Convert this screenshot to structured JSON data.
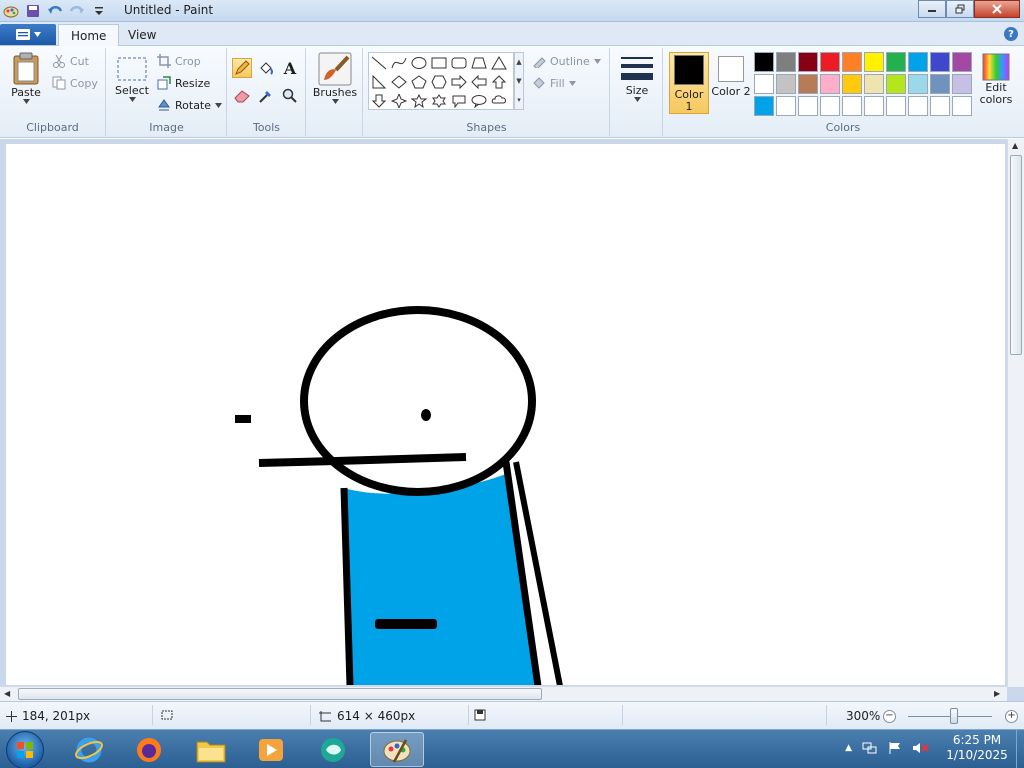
{
  "window": {
    "title": "Untitled - Paint"
  },
  "tabs": [
    {
      "label": "Home"
    },
    {
      "label": "View"
    }
  ],
  "clipboard": {
    "paste": "Paste",
    "cut": "Cut",
    "copy": "Copy",
    "group": "Clipboard"
  },
  "image": {
    "select": "Select",
    "crop": "Crop",
    "resize": "Resize",
    "rotate": "Rotate",
    "group": "Image"
  },
  "tools": {
    "group": "Tools"
  },
  "brushes": {
    "label": "Brushes"
  },
  "shapes": {
    "outline": "Outline",
    "fill": "Fill",
    "group": "Shapes"
  },
  "size": {
    "label": "Size"
  },
  "colors": {
    "color1": "Color 1",
    "color2": "Color 2",
    "color1_value": "#000000",
    "color2_value": "#ffffff",
    "edit": "Edit colors",
    "group": "Colors",
    "palette": [
      "#000000",
      "#7f7f7f",
      "#880015",
      "#ed1c24",
      "#ff7f27",
      "#fff200",
      "#22b14c",
      "#00a2e8",
      "#3f48cc",
      "#a349a4",
      "#ffffff",
      "#c3c3c3",
      "#b97a57",
      "#ffaec9",
      "#ffc90e",
      "#efe4b0",
      "#b5e61d",
      "#99d9ea",
      "#7092be",
      "#c8bfe7",
      "#00a2e8",
      "#ffffff",
      "#ffffff",
      "#ffffff",
      "#ffffff",
      "#ffffff",
      "#ffffff",
      "#ffffff",
      "#ffffff",
      "#ffffff"
    ]
  },
  "status": {
    "cursor": "184, 201px",
    "selection": "",
    "canvas_size": "614 × 460px",
    "zoom": "300%",
    "zoom_level": 0.55
  },
  "taskbar": {
    "time": "6:25 PM",
    "date": "1/10/2025"
  }
}
